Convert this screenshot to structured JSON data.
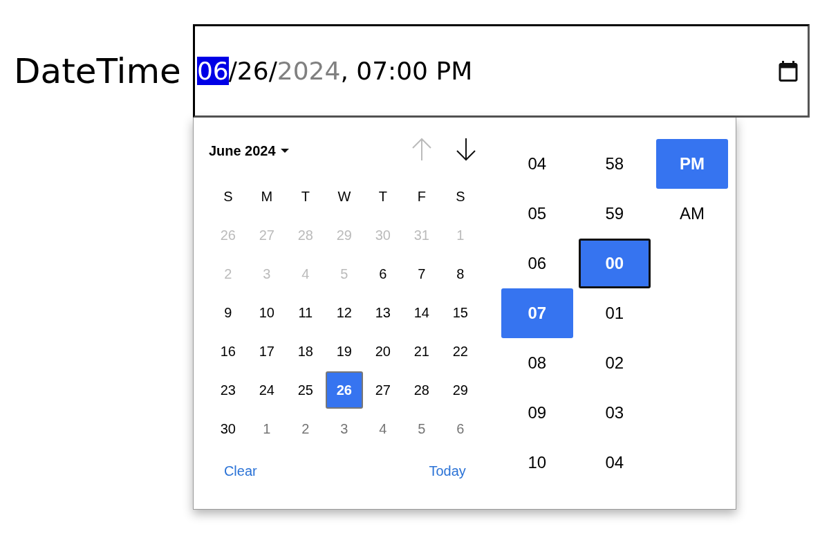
{
  "label": "DateTime",
  "field": {
    "segments": [
      {
        "text": "06",
        "kind": "selected"
      },
      {
        "text": "/26/",
        "kind": "normal"
      },
      {
        "text": "2024",
        "kind": "dim"
      },
      {
        "text": ", 07:00 PM",
        "kind": "normal"
      }
    ]
  },
  "calendar": {
    "month_label": "June 2024",
    "prev_disabled": true,
    "next_disabled": false,
    "weekdays": [
      "S",
      "M",
      "T",
      "W",
      "T",
      "F",
      "S"
    ],
    "weeks": [
      [
        {
          "day": "26",
          "kind": "disabled",
          "selected": false
        },
        {
          "day": "27",
          "kind": "disabled",
          "selected": false
        },
        {
          "day": "28",
          "kind": "disabled",
          "selected": false
        },
        {
          "day": "29",
          "kind": "disabled",
          "selected": false
        },
        {
          "day": "30",
          "kind": "disabled",
          "selected": false
        },
        {
          "day": "31",
          "kind": "disabled",
          "selected": false
        },
        {
          "day": "1",
          "kind": "disabled",
          "selected": false
        }
      ],
      [
        {
          "day": "2",
          "kind": "disabled",
          "selected": false
        },
        {
          "day": "3",
          "kind": "disabled",
          "selected": false
        },
        {
          "day": "4",
          "kind": "disabled",
          "selected": false
        },
        {
          "day": "5",
          "kind": "disabled",
          "selected": false
        },
        {
          "day": "6",
          "kind": "normal",
          "selected": false
        },
        {
          "day": "7",
          "kind": "normal",
          "selected": false
        },
        {
          "day": "8",
          "kind": "normal",
          "selected": false
        }
      ],
      [
        {
          "day": "9",
          "kind": "normal",
          "selected": false
        },
        {
          "day": "10",
          "kind": "normal",
          "selected": false
        },
        {
          "day": "11",
          "kind": "normal",
          "selected": false
        },
        {
          "day": "12",
          "kind": "normal",
          "selected": false
        },
        {
          "day": "13",
          "kind": "normal",
          "selected": false
        },
        {
          "day": "14",
          "kind": "normal",
          "selected": false
        },
        {
          "day": "15",
          "kind": "normal",
          "selected": false
        }
      ],
      [
        {
          "day": "16",
          "kind": "normal",
          "selected": false
        },
        {
          "day": "17",
          "kind": "normal",
          "selected": false
        },
        {
          "day": "18",
          "kind": "normal",
          "selected": false
        },
        {
          "day": "19",
          "kind": "normal",
          "selected": false
        },
        {
          "day": "20",
          "kind": "normal",
          "selected": false
        },
        {
          "day": "21",
          "kind": "normal",
          "selected": false
        },
        {
          "day": "22",
          "kind": "normal",
          "selected": false
        }
      ],
      [
        {
          "day": "23",
          "kind": "normal",
          "selected": false
        },
        {
          "day": "24",
          "kind": "normal",
          "selected": false
        },
        {
          "day": "25",
          "kind": "normal",
          "selected": false
        },
        {
          "day": "26",
          "kind": "normal",
          "selected": true
        },
        {
          "day": "27",
          "kind": "normal",
          "selected": false
        },
        {
          "day": "28",
          "kind": "normal",
          "selected": false
        },
        {
          "day": "29",
          "kind": "normal",
          "selected": false
        }
      ],
      [
        {
          "day": "30",
          "kind": "normal",
          "selected": false
        },
        {
          "day": "1",
          "kind": "outside",
          "selected": false
        },
        {
          "day": "2",
          "kind": "outside",
          "selected": false
        },
        {
          "day": "3",
          "kind": "outside",
          "selected": false
        },
        {
          "day": "4",
          "kind": "outside",
          "selected": false
        },
        {
          "day": "5",
          "kind": "outside",
          "selected": false
        },
        {
          "day": "6",
          "kind": "outside",
          "selected": false
        }
      ]
    ],
    "clear": "Clear",
    "today": "Today"
  },
  "time": {
    "columns": [
      [
        {
          "text": "04",
          "selected": false,
          "focused": false
        },
        {
          "text": "05",
          "selected": false,
          "focused": false
        },
        {
          "text": "06",
          "selected": false,
          "focused": false
        },
        {
          "text": "07",
          "selected": true,
          "focused": false
        },
        {
          "text": "08",
          "selected": false,
          "focused": false
        },
        {
          "text": "09",
          "selected": false,
          "focused": false
        },
        {
          "text": "10",
          "selected": false,
          "focused": false
        }
      ],
      [
        {
          "text": "58",
          "selected": false,
          "focused": false
        },
        {
          "text": "59",
          "selected": false,
          "focused": false
        },
        {
          "text": "00",
          "selected": true,
          "focused": true
        },
        {
          "text": "01",
          "selected": false,
          "focused": false
        },
        {
          "text": "02",
          "selected": false,
          "focused": false
        },
        {
          "text": "03",
          "selected": false,
          "focused": false
        },
        {
          "text": "04",
          "selected": false,
          "focused": false
        }
      ],
      [
        {
          "text": "PM",
          "selected": true,
          "focused": false
        },
        {
          "text": "AM",
          "selected": false,
          "focused": false
        }
      ]
    ]
  }
}
